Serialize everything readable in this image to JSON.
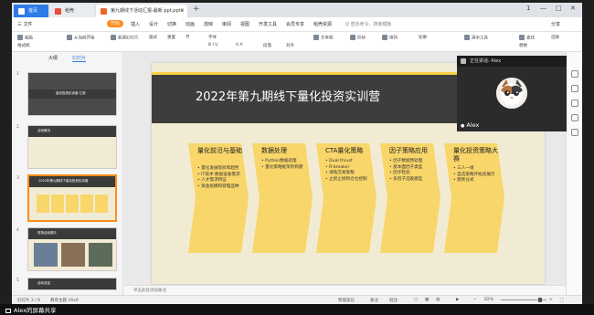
{
  "titlebar": {
    "tabs": [
      {
        "label": "首页"
      },
      {
        "label": "稻壳"
      },
      {
        "label": "第九期线下活动汇报-最新.ppt.pptx"
      }
    ],
    "add_tab": "+",
    "win_controls": [
      "1",
      "—",
      "□",
      "✕"
    ]
  },
  "menubar": {
    "file": "三 文件",
    "items": [
      "开始",
      "插入",
      "设计",
      "切换",
      "动画",
      "放映",
      "审阅",
      "视图",
      "开发工具",
      "会员专享",
      "稻壳资源"
    ],
    "search": "Q 查找命令、搜索模板",
    "share": "分享"
  },
  "ribbon": {
    "row1": [
      "粘贴",
      "从当前开始",
      "新建幻灯片",
      "版式",
      "重置",
      "节",
      "字体",
      "文本框",
      "形状",
      "排列",
      "轮廓",
      "演示工具",
      "查找",
      "替换",
      "选择"
    ],
    "row2": [
      "格式刷",
      "B I U",
      "A A",
      "段落",
      "对齐"
    ]
  },
  "leftpanel": {
    "tabs": [
      "大纲",
      "幻灯片"
    ],
    "thumbs": [
      {
        "num": "1",
        "label": "量化投资实训营 汇报"
      },
      {
        "num": "2",
        "label": "活动概况"
      },
      {
        "num": "3",
        "label": "2022年第九期线下量化投资实训营"
      },
      {
        "num": "4",
        "label": "现场活动照片"
      },
      {
        "num": "5",
        "label": "活动总结"
      }
    ]
  },
  "slide": {
    "title": "2022年第九期线下量化投资实训营",
    "columns": [
      {
        "title": "量化前沿与基础",
        "items": [
          "量化发展现状和趋势",
          "IT技术·数据设备需求",
          "人才需求特征",
          "资金规模和管理品种"
        ]
      },
      {
        "title": "数据处理",
        "items": [
          "Python数据处理",
          "量化策略框架的构建"
        ]
      },
      {
        "title": "CTA量化策略",
        "items": [
          "Dual thrust",
          "R-breaker",
          "海龟交易策略",
          "止损止损和仓位控制"
        ]
      },
      {
        "title": "因子策略应用",
        "items": [
          "因子数据预处理",
          "基本面因子类型",
          "因子检验",
          "多因子选股模型"
        ]
      },
      {
        "title": "量化投资策略大赛",
        "items": [
          "三人一组",
          "自选策略开始双展示",
          "颁奖仪式"
        ]
      }
    ]
  },
  "notes": "单击此处添加备注",
  "statusbar": {
    "slide_count": "幻灯片 3 / 8",
    "theme": "教育主题 16x9",
    "smart": "智能美化",
    "notes_toggle": "备注",
    "comment": "批注",
    "zoom": "82%"
  },
  "video": {
    "speaker_label": "正在讲话: Alex",
    "name": "Alex"
  },
  "share_banner": "Alex的屏幕共享",
  "watermark": "logi",
  "colors": {
    "accent": "#ff8c1a",
    "slide_bg": "#f2ebd4",
    "chevron": "#f9d66a",
    "header": "#3d3d3d"
  }
}
